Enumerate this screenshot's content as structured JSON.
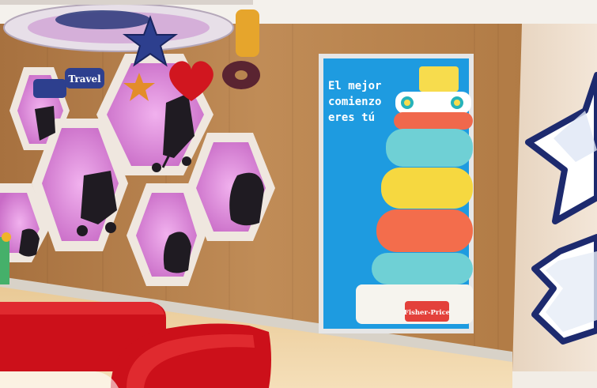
{
  "poster": {
    "line1": "El mejor",
    "line2": "comienzo",
    "line3": "eres tú",
    "brand": "Fisher-Price"
  },
  "signs": {
    "travel": "Travel"
  },
  "colors": {
    "wood_wall": "#b8854f",
    "hex_inner": "#d98ad6",
    "poster_bg": "#1e9be0",
    "brand_red": "#e3413b",
    "sofa_red": "#c9121c",
    "star_navy": "#1d2a6e"
  }
}
